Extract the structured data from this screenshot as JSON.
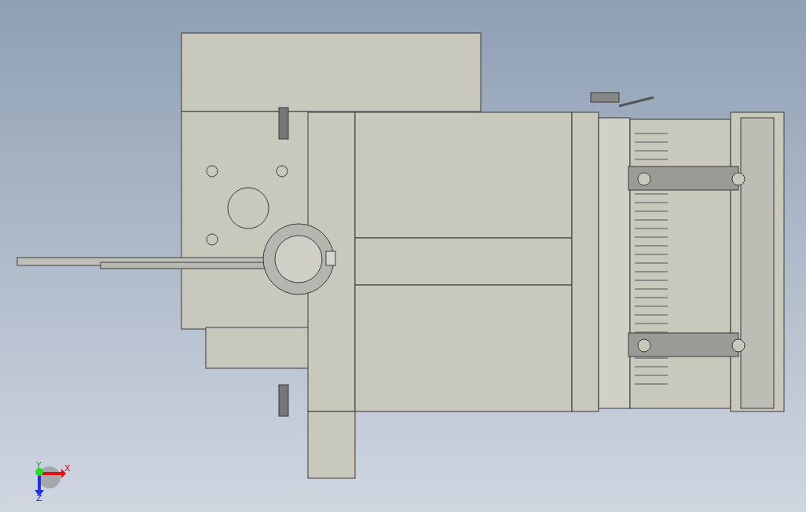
{
  "axis_triad": {
    "x_label": "X",
    "y_label": "Y",
    "z_label": "Z"
  }
}
